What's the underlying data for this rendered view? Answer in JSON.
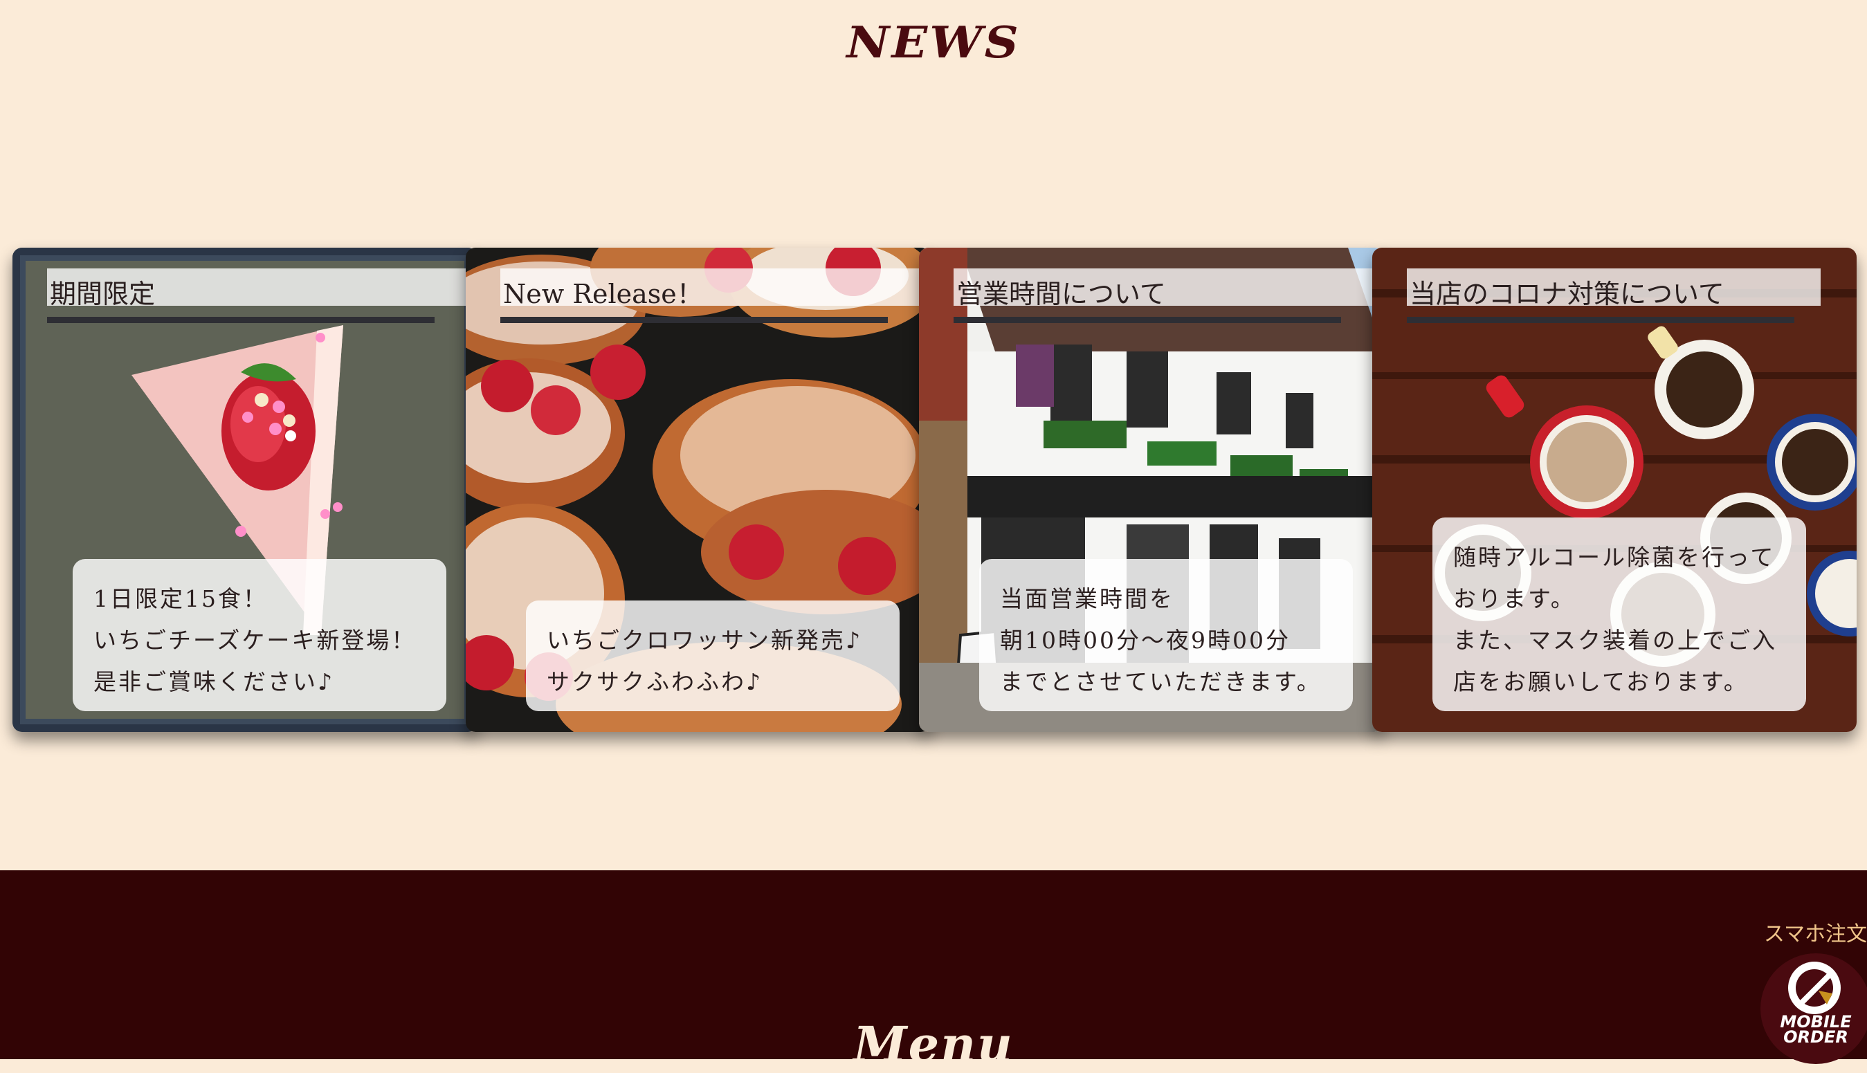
{
  "news": {
    "title": "NEWS"
  },
  "cards": [
    {
      "title": "期間限定",
      "lines": [
        "1日限定15食！",
        "いちごチーズケーキ新登場！",
        "是非ご賞味ください♪"
      ]
    },
    {
      "title": "New Release！",
      "lines": [
        "いちごクロワッサン新発売♪",
        "サクサクふわふわ♪"
      ]
    },
    {
      "title": "営業時間について",
      "lines": [
        "当面営業時間を",
        "朝10時00分～夜9時00分",
        "までとさせていただきます。"
      ]
    },
    {
      "title": "当店のコロナ対策について",
      "lines": [
        "随時アルコール除菌を行って",
        "おります。",
        "また、マスク装着の上でご入",
        "店をお願いしております。"
      ]
    }
  ],
  "footer": {
    "menu_title": "Menu",
    "mobile_order_label": "スマホ注文",
    "mobile_order_logo_text": "MOBILE ORDER"
  },
  "icons": [
    "cheesecake-image",
    "croissant-image",
    "storefront-image",
    "coffee-cups-image",
    "mobile-order-icon"
  ],
  "colors": {
    "page_bg": "#fbebd8",
    "heading": "#4a0a0f",
    "footer_bg": "#320405",
    "footer_accent": "#f0c58a"
  }
}
